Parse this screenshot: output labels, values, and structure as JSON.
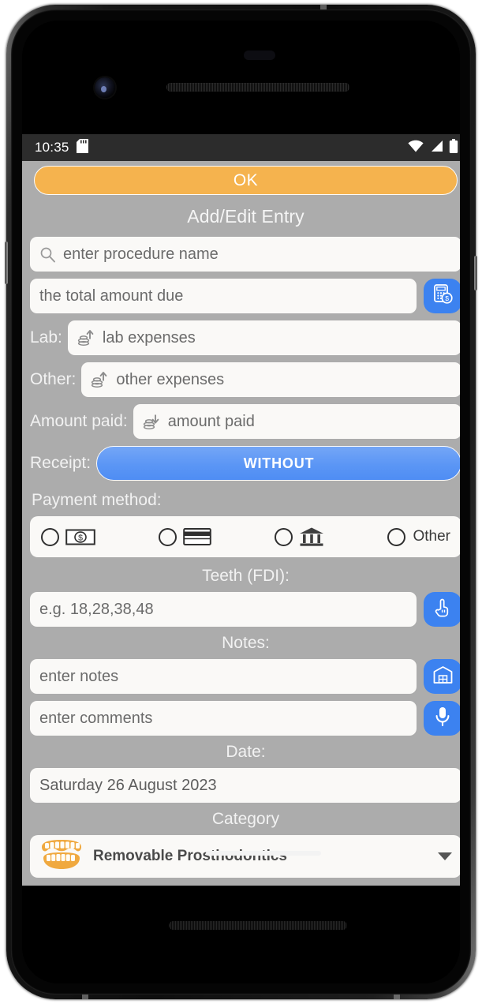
{
  "status_bar": {
    "time": "10:35",
    "icons": [
      "sd-card-icon",
      "wifi-icon",
      "signal-icon",
      "battery-icon"
    ]
  },
  "app": {
    "ok_label": "OK",
    "title": "Add/Edit Entry"
  },
  "fields": {
    "procedure": {
      "placeholder": "enter procedure name",
      "icon": "search-icon"
    },
    "total_amount": {
      "placeholder": "the total amount due",
      "action_icon": "calculator-dollar-icon"
    },
    "lab": {
      "label": "Lab:",
      "placeholder": "lab expenses",
      "icon": "coins-up-icon"
    },
    "other": {
      "label": "Other:",
      "placeholder": "other expenses",
      "icon": "coins-up-icon"
    },
    "amount_paid": {
      "label": "Amount paid:",
      "placeholder": "amount paid",
      "icon": "coins-down-icon"
    },
    "receipt": {
      "label": "Receipt:",
      "value": "WITHOUT"
    },
    "teeth": {
      "section": "Teeth (FDI):",
      "placeholder": "e.g. 18,28,38,48",
      "action_icon": "pointing-hand-icon"
    },
    "notes": {
      "section": "Notes:",
      "placeholder": "enter notes",
      "action_icon": "archive-icon"
    },
    "comments": {
      "placeholder": "enter comments",
      "action_icon": "microphone-icon"
    },
    "date": {
      "section": "Date:",
      "value": "Saturday 26 August 2023"
    },
    "category": {
      "section": "Category",
      "value": "Removable Prosthodontics",
      "icon": "dentures-icon"
    }
  },
  "payment_method": {
    "label": "Payment method:",
    "options": [
      {
        "name": "cash",
        "icon": "banknote-icon",
        "label": "",
        "selected": false
      },
      {
        "name": "card",
        "icon": "credit-card-icon",
        "label": "",
        "selected": false
      },
      {
        "name": "bank",
        "icon": "bank-icon",
        "label": "",
        "selected": false
      },
      {
        "name": "other",
        "icon": "",
        "label": "Other",
        "selected": false
      }
    ]
  },
  "colors": {
    "background": "#acacac",
    "accent_orange": "#f5b34e",
    "accent_blue": "#3c82f0",
    "field_bg": "#faf9f7",
    "status_bar": "#2c2c2c"
  }
}
